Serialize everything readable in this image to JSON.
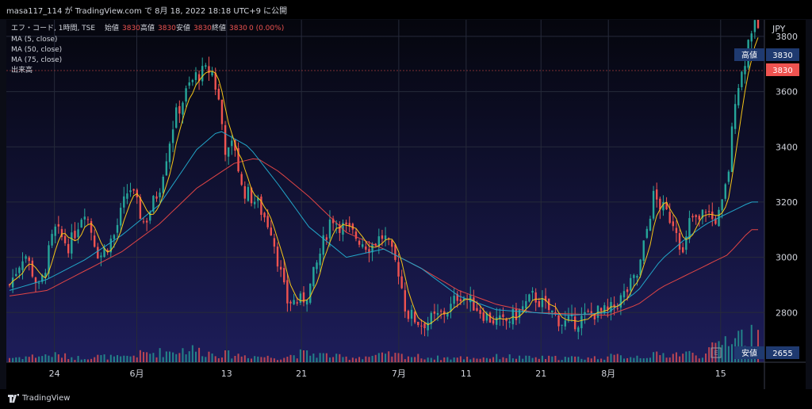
{
  "header": {
    "text": "masa117_114 が TradingView.com で 8月 18, 2022 18:18 UTC+9 に公開"
  },
  "legend": {
    "title": "エフ・コード, 1時間, TSE",
    "o_label": "始値",
    "o_val": "3830",
    "h_label": "高値",
    "h_val": "3830",
    "l_label": "安値",
    "l_val": "3830",
    "c_label": "終値",
    "c_val": "3830",
    "change": "0 (0.00%)",
    "ma5": "MA (5, close)",
    "ma50": "MA (50, close)",
    "ma75": "MA (75, close)",
    "vol": "出来高"
  },
  "price_axis": {
    "currency": "JPY",
    "high_label": "高値",
    "high_val": "3830",
    "last_val": "3830",
    "low_label": "安値",
    "low_val": "2655",
    "e_marker": "E"
  },
  "footer": {
    "brand": "TradingView"
  },
  "colors": {
    "bg": "#0b0d16",
    "up": "#26a69a",
    "down": "#ef5350",
    "ma5": "#f5c518",
    "ma50": "#22a6c9",
    "ma75": "#e04545",
    "grid": "#262a3a"
  },
  "chart_data": {
    "type": "candlestick",
    "title": "エフ・コード, 1時間, TSE",
    "ylim": [
      2620,
      3860
    ],
    "y_ticks": [
      2800,
      3000,
      3200,
      3400,
      3600,
      3800
    ],
    "x_ticks": [
      {
        "label": "24",
        "t": 0.06
      },
      {
        "label": "6月",
        "t": 0.17
      },
      {
        "label": "13",
        "t": 0.29
      },
      {
        "label": "21",
        "t": 0.39
      },
      {
        "label": "7月",
        "t": 0.52
      },
      {
        "label": "11",
        "t": 0.61
      },
      {
        "label": "21",
        "t": 0.71
      },
      {
        "label": "8月",
        "t": 0.8
      },
      {
        "label": "15",
        "t": 0.95
      }
    ],
    "series": [
      {
        "name": "price",
        "points": [
          [
            0,
            2900
          ],
          [
            0.02,
            3020
          ],
          [
            0.04,
            2880
          ],
          [
            0.06,
            3100
          ],
          [
            0.08,
            3040
          ],
          [
            0.1,
            3180
          ],
          [
            0.12,
            3000
          ],
          [
            0.14,
            3080
          ],
          [
            0.16,
            3260
          ],
          [
            0.18,
            3120
          ],
          [
            0.2,
            3250
          ],
          [
            0.22,
            3500
          ],
          [
            0.24,
            3620
          ],
          [
            0.25,
            3660
          ],
          [
            0.27,
            3680
          ],
          [
            0.28,
            3560
          ],
          [
            0.29,
            3360
          ],
          [
            0.3,
            3420
          ],
          [
            0.31,
            3250
          ],
          [
            0.33,
            3200
          ],
          [
            0.35,
            3100
          ],
          [
            0.36,
            2970
          ],
          [
            0.37,
            2840
          ],
          [
            0.39,
            2840
          ],
          [
            0.4,
            2880
          ],
          [
            0.42,
            3060
          ],
          [
            0.43,
            3150
          ],
          [
            0.44,
            3120
          ],
          [
            0.46,
            3080
          ],
          [
            0.48,
            3040
          ],
          [
            0.5,
            3080
          ],
          [
            0.52,
            2950
          ],
          [
            0.53,
            2800
          ],
          [
            0.55,
            2760
          ],
          [
            0.57,
            2780
          ],
          [
            0.59,
            2820
          ],
          [
            0.6,
            2870
          ],
          [
            0.62,
            2830
          ],
          [
            0.64,
            2780
          ],
          [
            0.66,
            2760
          ],
          [
            0.68,
            2800
          ],
          [
            0.7,
            2860
          ],
          [
            0.72,
            2810
          ],
          [
            0.74,
            2760
          ],
          [
            0.76,
            2770
          ],
          [
            0.78,
            2800
          ],
          [
            0.8,
            2800
          ],
          [
            0.82,
            2860
          ],
          [
            0.84,
            2940
          ],
          [
            0.85,
            3080
          ],
          [
            0.86,
            3220
          ],
          [
            0.88,
            3150
          ],
          [
            0.89,
            3120
          ],
          [
            0.9,
            3000
          ],
          [
            0.91,
            3150
          ],
          [
            0.92,
            3120
          ],
          [
            0.93,
            3180
          ],
          [
            0.94,
            3130
          ],
          [
            0.95,
            3160
          ],
          [
            0.96,
            3300
          ],
          [
            0.97,
            3600
          ],
          [
            0.98,
            3680
          ],
          [
            0.99,
            3830
          ]
        ]
      },
      {
        "name": "MA (50, close)",
        "points": [
          [
            0,
            2880
          ],
          [
            0.05,
            2920
          ],
          [
            0.1,
            2990
          ],
          [
            0.15,
            3080
          ],
          [
            0.2,
            3190
          ],
          [
            0.25,
            3390
          ],
          [
            0.28,
            3460
          ],
          [
            0.32,
            3400
          ],
          [
            0.36,
            3260
          ],
          [
            0.4,
            3110
          ],
          [
            0.45,
            3000
          ],
          [
            0.5,
            3030
          ],
          [
            0.55,
            2960
          ],
          [
            0.6,
            2860
          ],
          [
            0.65,
            2810
          ],
          [
            0.7,
            2800
          ],
          [
            0.75,
            2790
          ],
          [
            0.8,
            2800
          ],
          [
            0.84,
            2880
          ],
          [
            0.87,
            2990
          ],
          [
            0.9,
            3060
          ],
          [
            0.93,
            3120
          ],
          [
            0.96,
            3160
          ],
          [
            0.99,
            3200
          ]
        ]
      },
      {
        "name": "MA (75, close)",
        "points": [
          [
            0,
            2860
          ],
          [
            0.05,
            2880
          ],
          [
            0.1,
            2950
          ],
          [
            0.15,
            3020
          ],
          [
            0.2,
            3120
          ],
          [
            0.25,
            3250
          ],
          [
            0.3,
            3340
          ],
          [
            0.33,
            3360
          ],
          [
            0.36,
            3310
          ],
          [
            0.4,
            3220
          ],
          [
            0.45,
            3090
          ],
          [
            0.5,
            3030
          ],
          [
            0.55,
            2960
          ],
          [
            0.6,
            2880
          ],
          [
            0.65,
            2830
          ],
          [
            0.7,
            2800
          ],
          [
            0.75,
            2795
          ],
          [
            0.8,
            2790
          ],
          [
            0.84,
            2830
          ],
          [
            0.87,
            2890
          ],
          [
            0.9,
            2930
          ],
          [
            0.93,
            2970
          ],
          [
            0.96,
            3010
          ],
          [
            0.99,
            3100
          ]
        ]
      }
    ],
    "volume_bars": [
      [
        0.0,
        0.3
      ],
      [
        0.03,
        0.4
      ],
      [
        0.06,
        0.5
      ],
      [
        0.09,
        0.3
      ],
      [
        0.12,
        0.4
      ],
      [
        0.15,
        0.3
      ],
      [
        0.18,
        0.6
      ],
      [
        0.21,
        0.7
      ],
      [
        0.24,
        0.9
      ],
      [
        0.27,
        0.6
      ],
      [
        0.3,
        0.5
      ],
      [
        0.33,
        0.4
      ],
      [
        0.36,
        0.3
      ],
      [
        0.39,
        0.6
      ],
      [
        0.42,
        0.5
      ],
      [
        0.45,
        0.3
      ],
      [
        0.48,
        0.4
      ],
      [
        0.51,
        0.5
      ],
      [
        0.54,
        0.4
      ],
      [
        0.57,
        0.3
      ],
      [
        0.6,
        0.3
      ],
      [
        0.63,
        0.3
      ],
      [
        0.66,
        0.4
      ],
      [
        0.69,
        0.3
      ],
      [
        0.72,
        0.3
      ],
      [
        0.75,
        0.3
      ],
      [
        0.78,
        0.3
      ],
      [
        0.81,
        0.4
      ],
      [
        0.84,
        0.4
      ],
      [
        0.87,
        0.5
      ],
      [
        0.9,
        0.6
      ],
      [
        0.93,
        0.5
      ],
      [
        0.955,
        1.6
      ],
      [
        0.97,
        1.9
      ],
      [
        0.985,
        1.7
      ]
    ]
  }
}
